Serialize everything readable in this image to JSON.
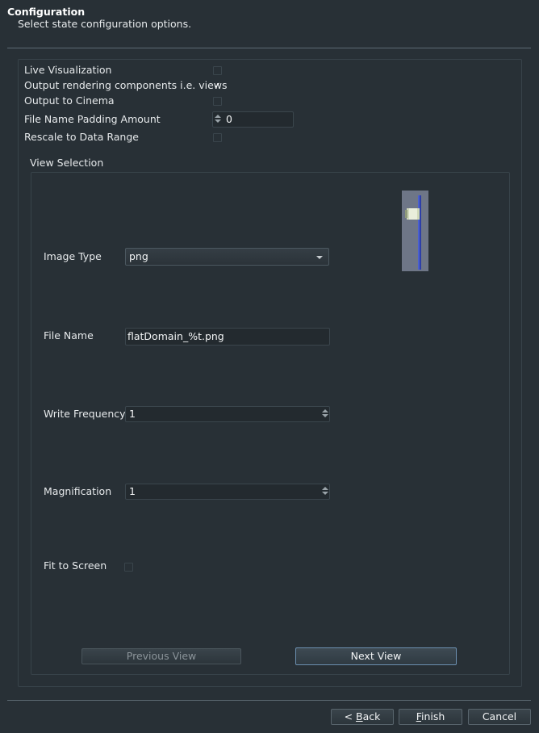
{
  "header": {
    "title": "Configuration",
    "subtitle": "Select state configuration options."
  },
  "options": {
    "live_visualization": {
      "label": "Live Visualization",
      "checked": false
    },
    "output_rendering": {
      "label": "Output rendering components i.e. views",
      "checked": true,
      "check_glyph": "✓"
    },
    "output_cinema": {
      "label": "Output to Cinema",
      "checked": false
    },
    "padding": {
      "label": "File Name Padding Amount",
      "value": "0"
    },
    "rescale": {
      "label": "Rescale to Data Range",
      "checked": false
    }
  },
  "view_selection": {
    "title": "View Selection",
    "image_type": {
      "label": "Image Type",
      "value": "png"
    },
    "file_name": {
      "label": "File Name",
      "value": "flatDomain_%t.png"
    },
    "write_frequency": {
      "label": "Write Frequency",
      "value": "1"
    },
    "magnification": {
      "label": "Magnification",
      "value": "1"
    },
    "fit_to_screen": {
      "label": "Fit to Screen",
      "checked": false
    },
    "previous_view": "Previous View",
    "next_view": "Next View"
  },
  "footer": {
    "back": {
      "mnemonic": "B",
      "rest": "ack",
      "prefix": "< "
    },
    "finish": {
      "mnemonic": "F",
      "rest": "inish"
    },
    "cancel": "Cancel"
  },
  "colors": {
    "background": "#283036",
    "field_background": "#232a2f",
    "preview_background": "#6e7687",
    "preview_object": "#2d3fa8"
  }
}
